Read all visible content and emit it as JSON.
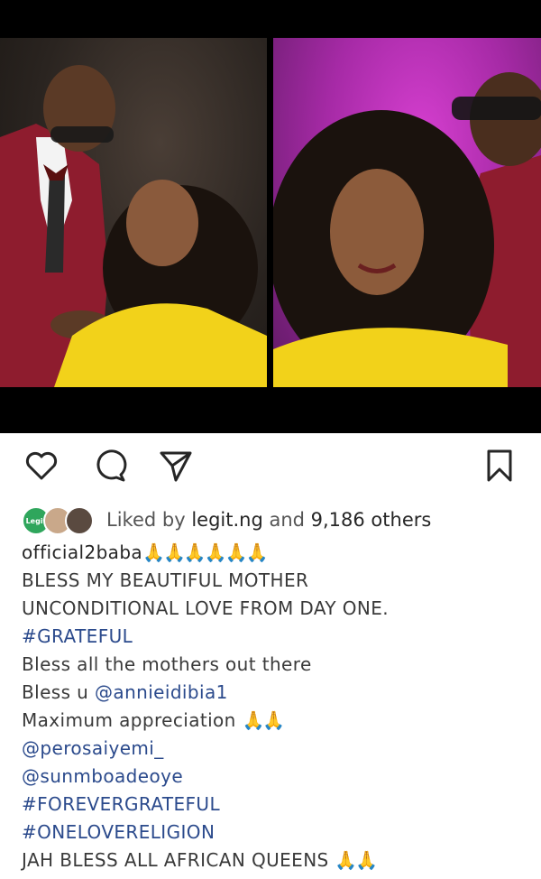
{
  "post": {
    "actions": {
      "like_icon": "heart-icon",
      "comment_icon": "comment-icon",
      "share_icon": "send-icon",
      "save_icon": "bookmark-icon"
    },
    "likes": {
      "prefix": "Liked by ",
      "user": "legit.ng",
      "middle": " and ",
      "others": "9,186 others",
      "avatar_badge": "Legit"
    },
    "caption": {
      "username": "official2baba",
      "username_emoji": "🙏🙏🙏🙏🙏🙏",
      "lines": [
        "BLESS MY BEAUTIFUL MOTHER",
        "UNCONDITIONAL LOVE FROM DAY ONE."
      ],
      "hashtag_grateful": "#GRATEFUL",
      "line_mothers": "Bless all the mothers out there",
      "bless_u_prefix": "Bless u ",
      "mention_annie": "@annieidibia1",
      "appreciation": "Maximum appreciation ",
      "appreciation_emoji": "🙏🙏",
      "mention_peros": "@perosaiyemi_",
      "mention_sunmbo": "@sunmboadeoye",
      "hashtag_forever": "#FOREVERGRATEFUL",
      "hashtag_onelove": "#ONELOVERELIGION",
      "final_line": "JAH BLESS  ALL AFRICAN QUEENS ",
      "final_emoji": "🙏🙏"
    }
  },
  "colors": {
    "link": "#2b4a8c",
    "text": "#262626",
    "left_bg": "#2a2420",
    "right_bg": "#a62aa6",
    "jacket": "#8e1c2e",
    "dress": "#f2d21a"
  }
}
